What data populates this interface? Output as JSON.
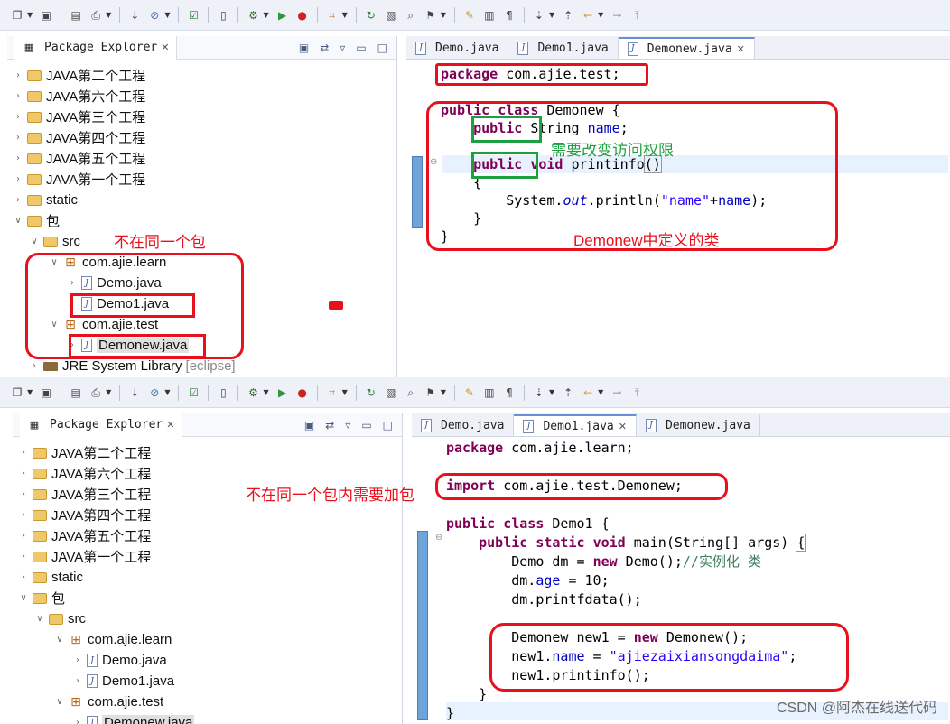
{
  "toolbar": {
    "icons": [
      "new-icon",
      "save-icon",
      "save-all-icon",
      "print-icon",
      "build-icon",
      "debug-icon",
      "check-icon",
      "new-file-icon",
      "gear-icon",
      "run-icon",
      "external-tools-icon",
      "new-package-icon",
      "refresh-icon",
      "open-type-icon",
      "search-icon",
      "pin-icon",
      "highlight-icon",
      "toggle-icon",
      "show-whitespace-icon",
      "next-annotation-icon",
      "prev-annotation-icon",
      "back-icon",
      "forward-icon",
      "pin-editor-icon"
    ]
  },
  "top": {
    "explorer": {
      "title": "Package Explorer",
      "items": [
        {
          "label": "JAVA第二个工程",
          "kind": "project"
        },
        {
          "label": "JAVA第六个工程",
          "kind": "project"
        },
        {
          "label": "JAVA第三个工程",
          "kind": "project"
        },
        {
          "label": "JAVA第四个工程",
          "kind": "project"
        },
        {
          "label": "JAVA第五个工程",
          "kind": "project"
        },
        {
          "label": "JAVA第一个工程",
          "kind": "project"
        },
        {
          "label": "static",
          "kind": "project"
        },
        {
          "label": "包",
          "kind": "project"
        },
        {
          "label": "src",
          "kind": "folder"
        },
        {
          "label": "com.ajie.learn",
          "kind": "package"
        },
        {
          "label": "Demo.java",
          "kind": "file"
        },
        {
          "label": "Demo1.java",
          "kind": "file"
        },
        {
          "label": "com.ajie.test",
          "kind": "package"
        },
        {
          "label": "Demonew.java",
          "kind": "file"
        },
        {
          "label": "JRE System Library",
          "kind": "library",
          "decoration": "[eclipse]"
        }
      ]
    },
    "tabs": [
      {
        "label": "Demo.java",
        "active": false
      },
      {
        "label": "Demo1.java",
        "active": false
      },
      {
        "label": "Demonew.java",
        "active": true
      }
    ],
    "annotations": {
      "not_same_package": "不在同一个包",
      "need_change_access": "需要改变访问权限",
      "class_defined": "Demonew中定义的类"
    }
  },
  "bottom": {
    "explorer": {
      "title": "Package Explorer",
      "items": [
        {
          "label": "JAVA第二个工程",
          "kind": "project"
        },
        {
          "label": "JAVA第六个工程",
          "kind": "project"
        },
        {
          "label": "JAVA第三个工程",
          "kind": "project"
        },
        {
          "label": "JAVA第四个工程",
          "kind": "project"
        },
        {
          "label": "JAVA第五个工程",
          "kind": "project"
        },
        {
          "label": "JAVA第一个工程",
          "kind": "project"
        },
        {
          "label": "static",
          "kind": "project"
        },
        {
          "label": "包",
          "kind": "project"
        },
        {
          "label": "src",
          "kind": "folder"
        },
        {
          "label": "com.ajie.learn",
          "kind": "package"
        },
        {
          "label": "Demo.java",
          "kind": "file"
        },
        {
          "label": "Demo1.java",
          "kind": "file"
        },
        {
          "label": "com.ajie.test",
          "kind": "package"
        },
        {
          "label": "Demonew.java",
          "kind": "file"
        }
      ]
    },
    "tabs": [
      {
        "label": "Demo.java",
        "active": false
      },
      {
        "label": "Demo1.java",
        "active": true
      },
      {
        "label": "Demonew.java",
        "active": false
      }
    ],
    "annotations": {
      "need_import": "不在同一个包内需要加包"
    }
  },
  "watermark": "CSDN @阿杰在线送代码"
}
